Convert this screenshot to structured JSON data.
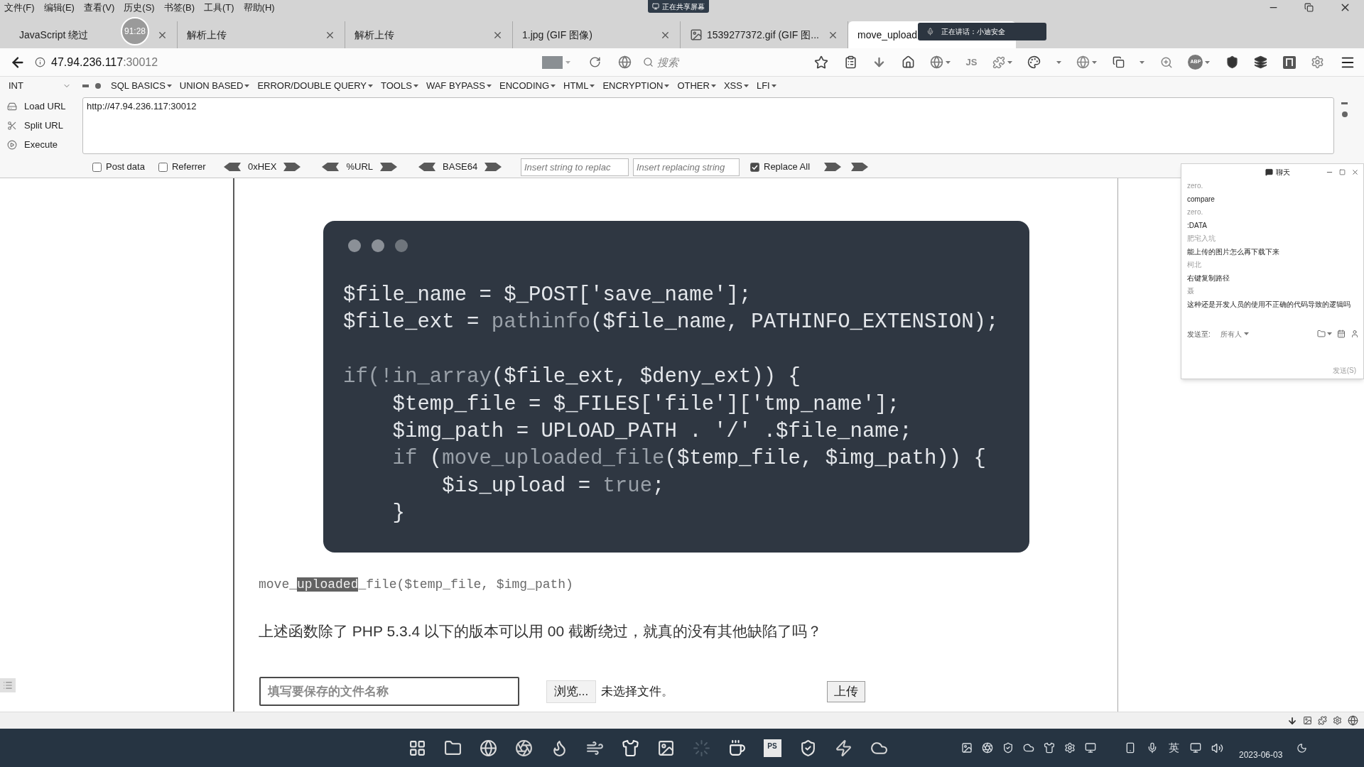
{
  "menu_bar": {
    "items": [
      "文件(F)",
      "编辑(E)",
      "查看(V)",
      "历史(S)",
      "书签(B)",
      "工具(T)",
      "帮助(H)"
    ],
    "sharing_notice": "正在共享屏幕"
  },
  "recording_timer": "91:28",
  "tabs": [
    {
      "label": "JavaScript 绕过",
      "kind": "page",
      "selected": false
    },
    {
      "label": "解析上传",
      "kind": "page",
      "selected": false
    },
    {
      "label": "解析上传",
      "kind": "page",
      "selected": false
    },
    {
      "label": "1.jpg (GIF 图像)",
      "kind": "page",
      "selected": false
    },
    {
      "label": "1539277372.gif (GIF 图...",
      "kind": "image",
      "selected": false
    },
    {
      "label": "move_upload",
      "kind": "page",
      "selected": true
    }
  ],
  "speaking_notice": "正在讲话：小迪安全",
  "address": {
    "host": "47.94.236.117",
    "port": ":30012"
  },
  "search": {
    "placeholder": "搜索"
  },
  "toolbar": {
    "script_badge": "JS",
    "adblock_badge": "ABP"
  },
  "hackbar": {
    "encoding": "INT",
    "menus": [
      "SQL BASICS",
      "UNION BASED",
      "ERROR/DOUBLE QUERY",
      "TOOLS",
      "WAF BYPASS",
      "ENCODING",
      "HTML",
      "ENCRYPTION",
      "OTHER",
      "XSS",
      "LFI"
    ],
    "actions": [
      "Load URL",
      "Split URL",
      "Execute"
    ],
    "url": "http://47.94.236.117:30012",
    "options": [
      {
        "label": "Post data",
        "checked": false
      },
      {
        "label": "Referrer",
        "checked": false
      }
    ],
    "encoders": [
      "0xHEX",
      "%URL",
      "BASE64"
    ],
    "replace_from": {
      "placeholder": "Insert string to replac"
    },
    "replace_to": {
      "placeholder": "Insert replacing string"
    },
    "replace_all": {
      "label": "Replace All",
      "checked": true
    }
  },
  "code_card": {
    "blocks": [
      [
        [
          {
            "kind": "plain",
            "text": "$file_name = $_POST['save_name'];"
          }
        ],
        [
          {
            "kind": "plain",
            "text": "$file_ext = "
          },
          {
            "kind": "call",
            "text": "pathinfo"
          },
          {
            "kind": "plain",
            "text": "($file_name, PATHINFO_EXTENSION);"
          }
        ]
      ],
      [
        [
          {
            "kind": "call",
            "text": "if(!in_array"
          },
          {
            "kind": "plain",
            "text": "($file_ext, $deny_ext)) {"
          }
        ],
        [
          {
            "kind": "plain",
            "text": "    $temp_file = $_FILES['file']['tmp_name'];"
          }
        ],
        [
          {
            "kind": "plain",
            "text": "    $img_path = UPLOAD_PATH . '/' .$file_name;"
          }
        ],
        [
          {
            "kind": "call",
            "text": "    if "
          },
          {
            "kind": "plain",
            "text": "("
          },
          {
            "kind": "call",
            "text": "move_uploaded_file"
          },
          {
            "kind": "plain",
            "text": "($temp_file, $img_path)) {"
          }
        ],
        [
          {
            "kind": "plain",
            "text": "        $is_upload = "
          },
          {
            "kind": "call",
            "text": "true"
          },
          {
            "kind": "plain",
            "text": ";"
          }
        ],
        [
          {
            "kind": "plain",
            "text": "    }"
          }
        ]
      ]
    ]
  },
  "inline_code": [
    {
      "text": "move_",
      "highlighted": false
    },
    {
      "text": "uploaded",
      "highlighted": true
    },
    {
      "text": "_file($temp_file, $img_path)",
      "highlighted": false
    }
  ],
  "question": "上述函数除了 PHP 5.3.4 以下的版本可以用 00 截断绕过，就真的没有其他缺陷了吗？",
  "upload_form": {
    "filename": {
      "placeholder": "填写要保存的文件名称"
    },
    "browse": "浏览...",
    "file_status": "未选择文件。",
    "submit": "上传"
  },
  "chat": {
    "title": "聊天",
    "messages": [
      {
        "kind": "sender",
        "text": "zero."
      },
      {
        "kind": "message",
        "text": "compare"
      },
      {
        "kind": "sender",
        "text": "zero."
      },
      {
        "kind": "message",
        "text": ":DATA"
      },
      {
        "kind": "sender",
        "text": "肥宅入坑"
      },
      {
        "kind": "message",
        "text": "能上传的图片怎么再下载下来"
      },
      {
        "kind": "sender",
        "text": "柯北"
      },
      {
        "kind": "message",
        "text": "右键复制路径"
      },
      {
        "kind": "sender",
        "text": "聂"
      },
      {
        "kind": "message",
        "text": "这种还是开发人员的使用不正确的代码导致的逻辑吗"
      }
    ],
    "send_to_label": "发送至:",
    "recipient": "所有人",
    "send_button": "发送(S)"
  },
  "taskbar": {
    "app_badge": "PS",
    "input_method": "英",
    "date": "2023-06-03"
  }
}
